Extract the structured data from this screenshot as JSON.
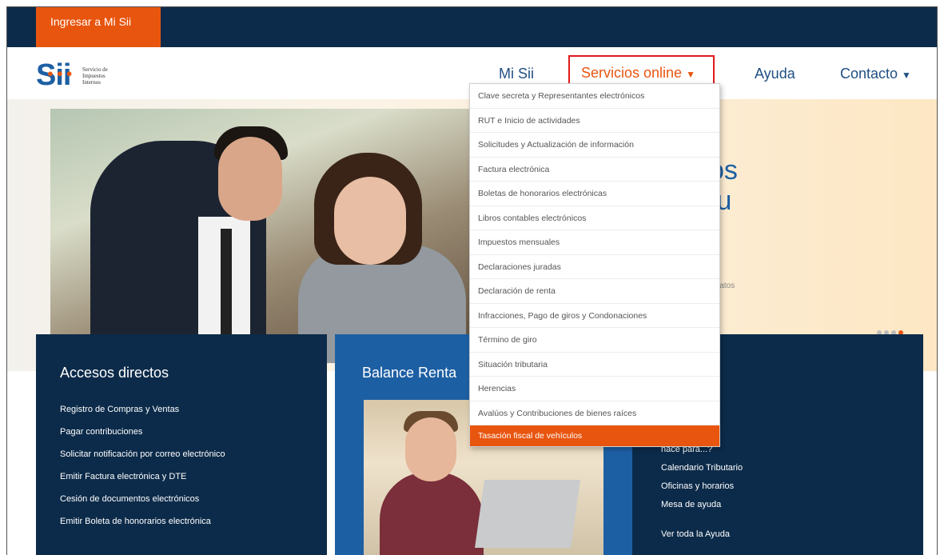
{
  "topbar": {
    "login_label": "Ingresar a Mi Sii"
  },
  "logo": {
    "mark": "Sii",
    "line1": "Servicio de",
    "line2": "Impuestos",
    "line3": "Internos"
  },
  "nav": {
    "mi_sii": "Mi Sii",
    "servicios": "Servicios online",
    "ayuda": "Ayuda",
    "contacto": "Contacto"
  },
  "hero": {
    "title_line1": "os",
    "title_line2": "tu",
    "sub1": ").",
    "sub2": "s datos"
  },
  "dropdown": {
    "items": [
      "Clave secreta y Representantes electrónicos",
      "RUT e Inicio de actividades",
      "Solicitudes y Actualización de información",
      "Factura electrónica",
      "Boletas de honorarios electrónicas",
      "Libros contables electrónicos",
      "Impuestos mensuales",
      "Declaraciones juradas",
      "Declaración de renta",
      "Infracciones, Pago de giros y Condonaciones",
      "Término de giro",
      "Situación tributaria",
      "Herencias",
      "Avalúos y Contribuciones de bienes raíces",
      "Tasación fiscal de vehículos"
    ],
    "selected_index": 14
  },
  "accesos": {
    "title": "Accesos directos",
    "links": [
      "Registro de Compras y Ventas",
      "Pagar contribuciones",
      "Solicitar notificación por correo electrónico",
      "Emitir Factura electrónica y DTE",
      "Cesión de documentos electrónicos",
      "Emitir Boleta de honorarios electrónica"
    ]
  },
  "balance": {
    "title": "Balance Renta"
  },
  "ayuda_panel": {
    "links": [
      "recuentes",
      "hace para...?",
      "Calendario Tributario",
      "Oficinas y horarios",
      "Mesa de ayuda",
      "Ver toda la Ayuda"
    ]
  },
  "colors": {
    "navy": "#0c2b4a",
    "orange": "#e8550f",
    "blue": "#1d5fa3",
    "highlight_red": "#e0191b"
  }
}
